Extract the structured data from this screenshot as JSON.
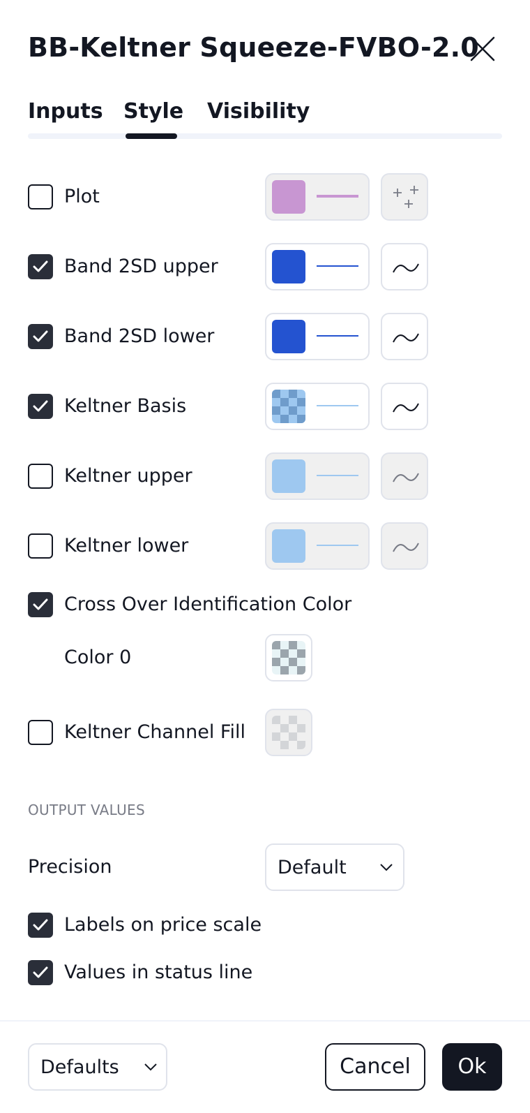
{
  "dialog": {
    "title": "BB-Keltner Squeeze-FVBO-2.0"
  },
  "tabs": [
    {
      "label": "Inputs",
      "active": false
    },
    {
      "label": "Style",
      "active": true
    },
    {
      "label": "Visibility",
      "active": false
    }
  ],
  "rows": [
    {
      "label": "Plot",
      "checked": false,
      "color": "#c896d2",
      "line": "thick",
      "icon": "crosses-icon"
    },
    {
      "label": "Band 2SD upper",
      "checked": true,
      "color": "#2453d0",
      "line": "thin",
      "icon": "line-style-icon"
    },
    {
      "label": "Band 2SD lower",
      "checked": true,
      "color": "#2453d0",
      "line": "thin",
      "icon": "line-style-icon"
    },
    {
      "label": "Keltner Basis",
      "checked": true,
      "color": "#90bfeb",
      "line": "thin",
      "icon": "line-style-icon"
    },
    {
      "label": "Keltner upper",
      "checked": false,
      "color": "#9ec8f0",
      "line": "thin",
      "icon": "line-style-icon"
    },
    {
      "label": "Keltner lower",
      "checked": false,
      "color": "#9ec8f0",
      "line": "thin",
      "icon": "line-style-icon"
    }
  ],
  "cross_over": {
    "label": "Cross Over Identification Color",
    "checked": true,
    "color0_label": "Color 0"
  },
  "channel_fill": {
    "label": "Keltner Channel Fill",
    "checked": false
  },
  "output_values": {
    "header": "OUTPUT VALUES",
    "precision_label": "Precision",
    "precision_value": "Default",
    "labels_on_price_scale": "Labels on price scale",
    "labels_on_price_scale_checked": true,
    "values_in_status_line": "Values in status line",
    "values_in_status_line_checked": true
  },
  "footer": {
    "defaults_label": "Defaults",
    "cancel_label": "Cancel",
    "ok_label": "Ok"
  }
}
